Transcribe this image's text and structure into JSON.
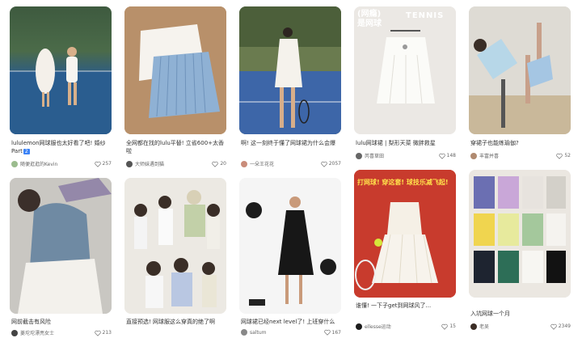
{
  "colors": {
    "accent": "#3b82f6",
    "text": "#333333",
    "meta": "#666666"
  },
  "cards": [
    {
      "title": "lululemon网球服也太好看了吧! 婚纱Part",
      "badge": "2",
      "user": "随便逛逛的Kevin",
      "likes": "257"
    },
    {
      "title": "全网都在找的lulu平替! 立省600+太香啦",
      "user": "大师妹遇到猫",
      "likes": "20"
    },
    {
      "title": "啊! 这一刻终于懂了网球裙为什么会爆",
      "user": "一朵王花花",
      "likes": "2057"
    },
    {
      "title": "lulu网球裙 | 梨形天菜 微胖救星",
      "user": "芮喜草田",
      "likes": "148",
      "overlay": "(网瘾)\n是网球",
      "overlay_en": "TENNIS"
    },
    {
      "title": "穿裙子也能练瑜伽?",
      "user": "丰富并喜",
      "likes": "52"
    },
    {
      "title": "网前截击有风险",
      "user": "菱坨坨漂亮女士",
      "likes": "213"
    },
    {
      "title": "直接预选! 网球服这么穿真的绝了啊",
      "user": "",
      "likes": ""
    },
    {
      "title": "网球裙已经next level了! 上班穿什么",
      "user": "saltum",
      "likes": "167"
    },
    {
      "title": "谁懂! 一下子get到网球风了...",
      "user": "ellesse运动",
      "likes": "15",
      "overlay": "打网球! 穿这套! 球技乐减飞起!"
    },
    {
      "title": "入坑网球一个月",
      "user": "老吴",
      "likes": "2349"
    }
  ]
}
